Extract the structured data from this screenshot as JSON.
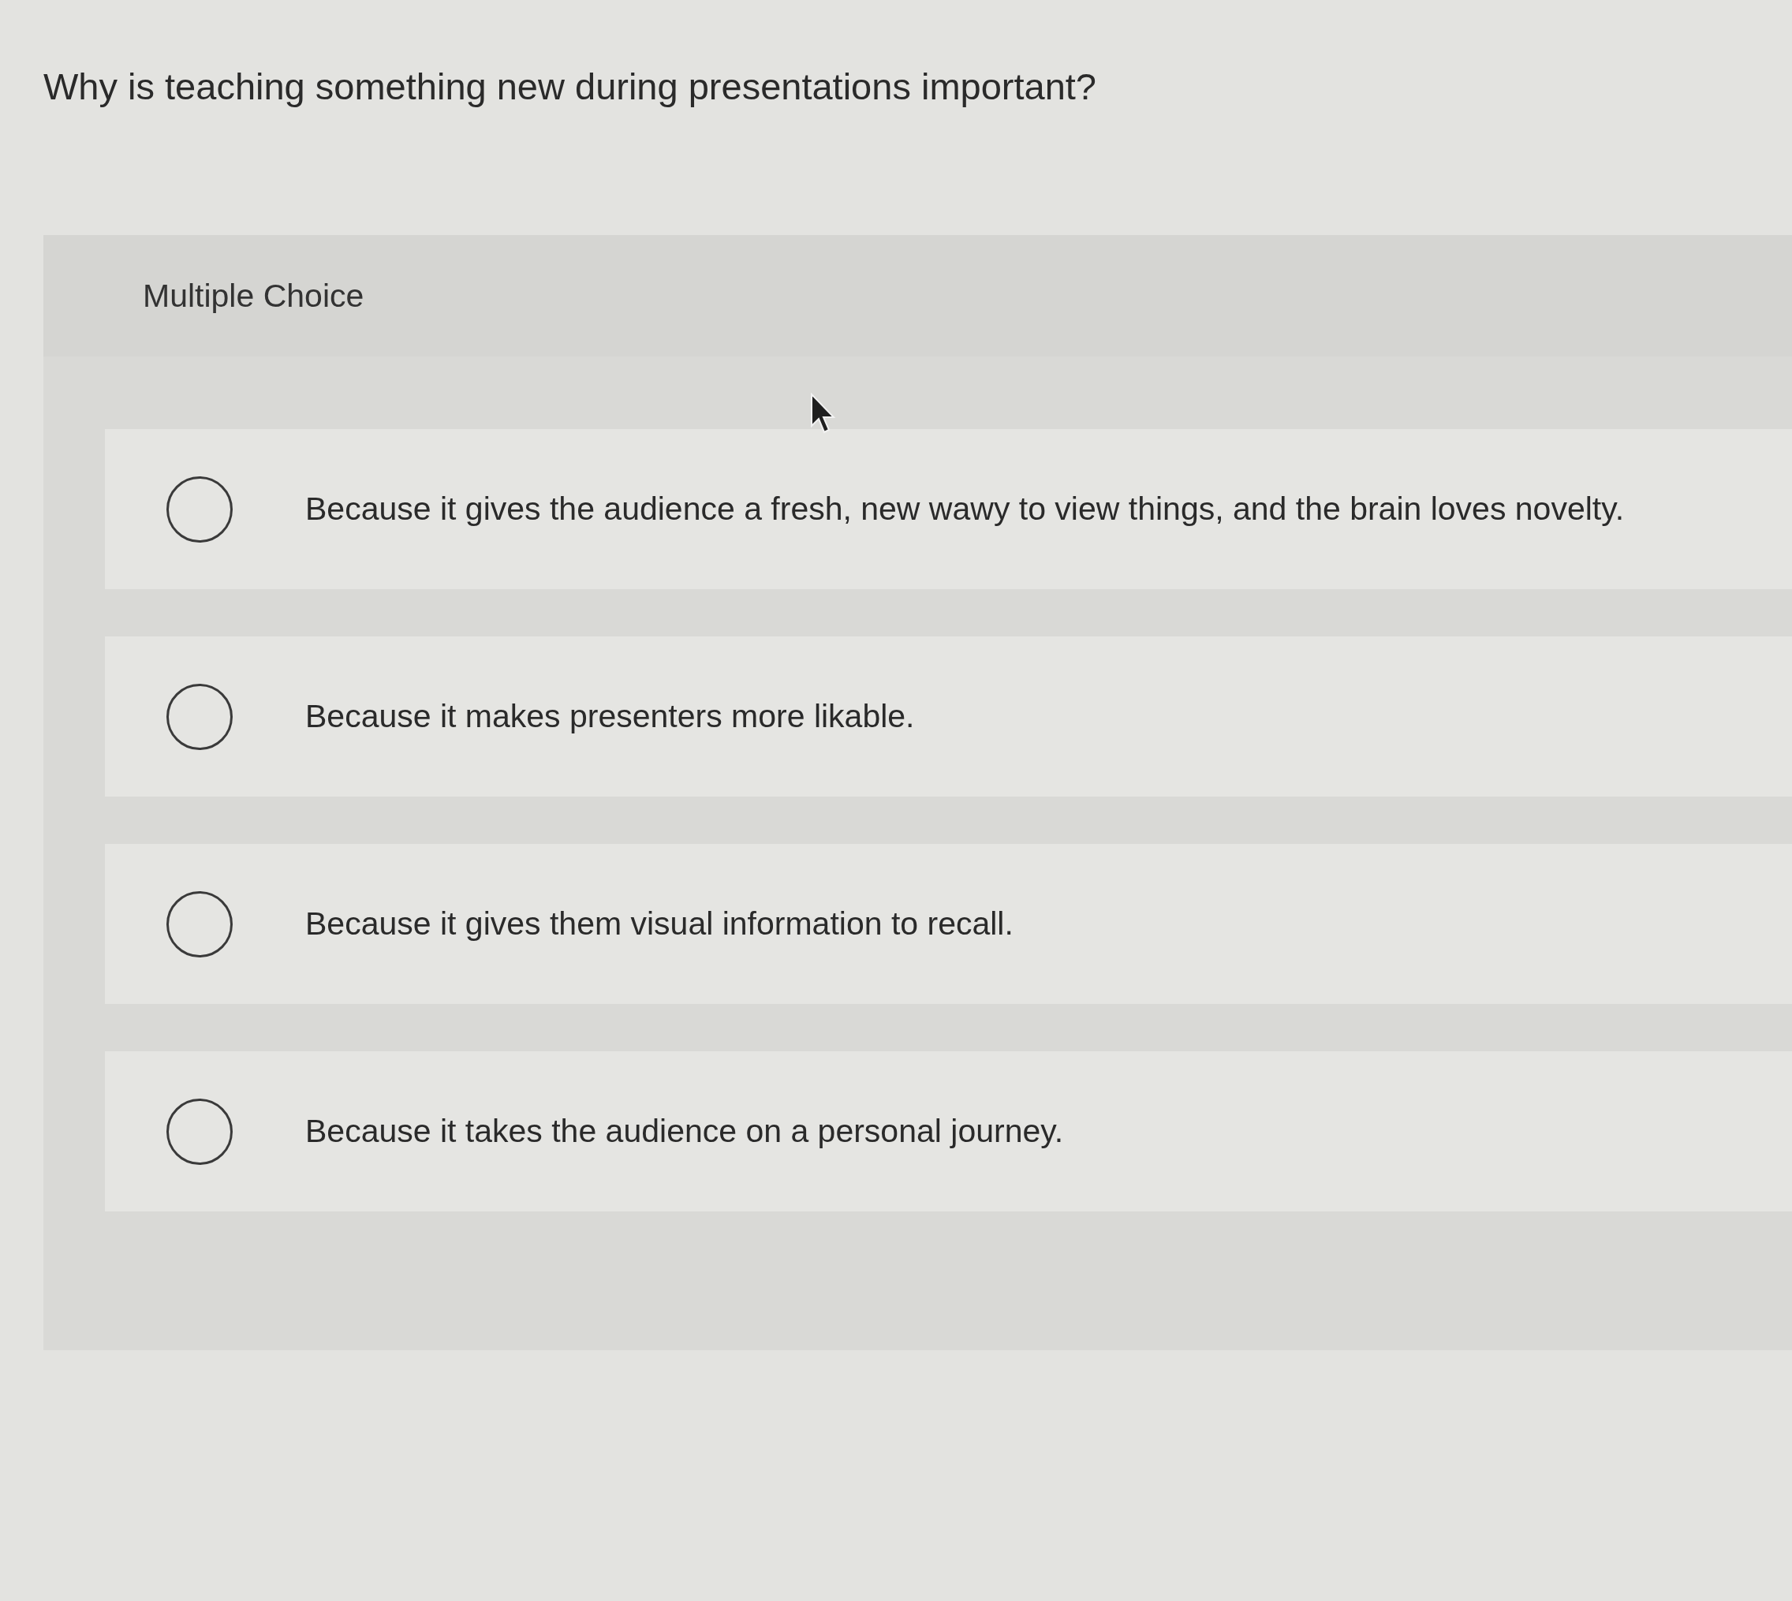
{
  "question": "Why is teaching something new during presentations important?",
  "panel": {
    "label": "Multiple Choice"
  },
  "options": [
    {
      "text": "Because it gives the audience a fresh, new wawy to view things, and the brain loves novelty.",
      "selected": false
    },
    {
      "text": "Because it makes presenters more likable.",
      "selected": false
    },
    {
      "text": "Because it gives them visual information to recall.",
      "selected": false
    },
    {
      "text": "Because it takes the audience on a personal journey.",
      "selected": false
    }
  ]
}
